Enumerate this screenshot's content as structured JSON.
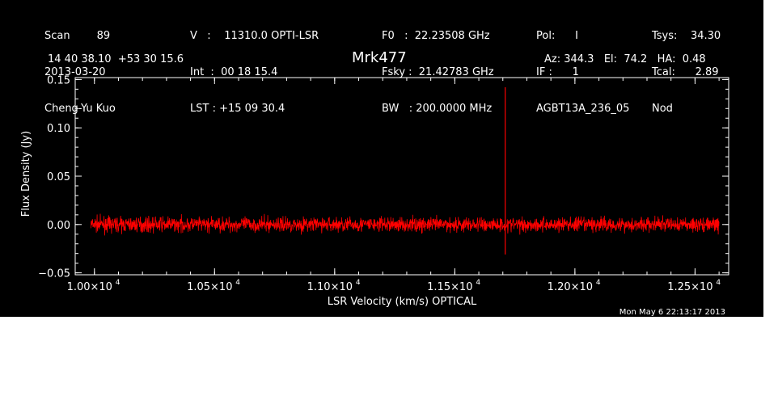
{
  "header": {
    "col1": [
      "Scan        89",
      "2013-03-20",
      "Cheng-Yu Kuo"
    ],
    "col2": [
      "V   :    11310.0 OPTI-LSR",
      "Int  :  00 18 15.4",
      "LST : +15 09 30.4"
    ],
    "col3": [
      "F0   :  22.23508 GHz",
      "Fsky :  21.42783 GHz",
      "BW   : 200.0000 MHz"
    ],
    "col4": [
      "Pol:      I",
      "IF :      1",
      "AGBT13A_236_05"
    ],
    "col5": [
      "Tsys:    34.30",
      "Tcal:      2.89",
      "Nod"
    ],
    "coords": "14 40 38.10  +53 30 15.6",
    "source": "Mrk477",
    "pointing": "Az: 344.3   El:  74.2   HA:  0.48",
    "timestamp": "Mon May  6 22:13:17 2013"
  },
  "colors": {
    "background": "#000000",
    "axes": "#ffffff",
    "trace": "#ff0000"
  },
  "chart_data": {
    "type": "line",
    "xlabel": "LSR Velocity (km/s) OPTICAL",
    "ylabel": "Flux Density (Jy)",
    "xlim": [
      9920,
      12640
    ],
    "ylim": [
      -0.052,
      0.152
    ],
    "xticks": [
      10000,
      10500,
      11000,
      11500,
      12000,
      12500
    ],
    "xtick_labels": [
      {
        "mantissa": "1.00×10",
        "exp": "4"
      },
      {
        "mantissa": "1.05×10",
        "exp": "4"
      },
      {
        "mantissa": "1.10×10",
        "exp": "4"
      },
      {
        "mantissa": "1.15×10",
        "exp": "4"
      },
      {
        "mantissa": "1.20×10",
        "exp": "4"
      },
      {
        "mantissa": "1.25×10",
        "exp": "4"
      }
    ],
    "yticks": [
      -0.05,
      0.0,
      0.05,
      0.1,
      0.15
    ],
    "ytick_labels": [
      "−0.05",
      "0.00",
      "0.05",
      "0.10",
      "0.15"
    ],
    "series": [
      {
        "baseline": 0.0,
        "x_range": [
          9985,
          12600
        ],
        "noise_amplitude": 0.01,
        "spikes": [
          {
            "x": 11710,
            "y": 0.142
          },
          {
            "x": 11710,
            "y": -0.031
          }
        ]
      }
    ],
    "grid": false,
    "legend": "none"
  }
}
